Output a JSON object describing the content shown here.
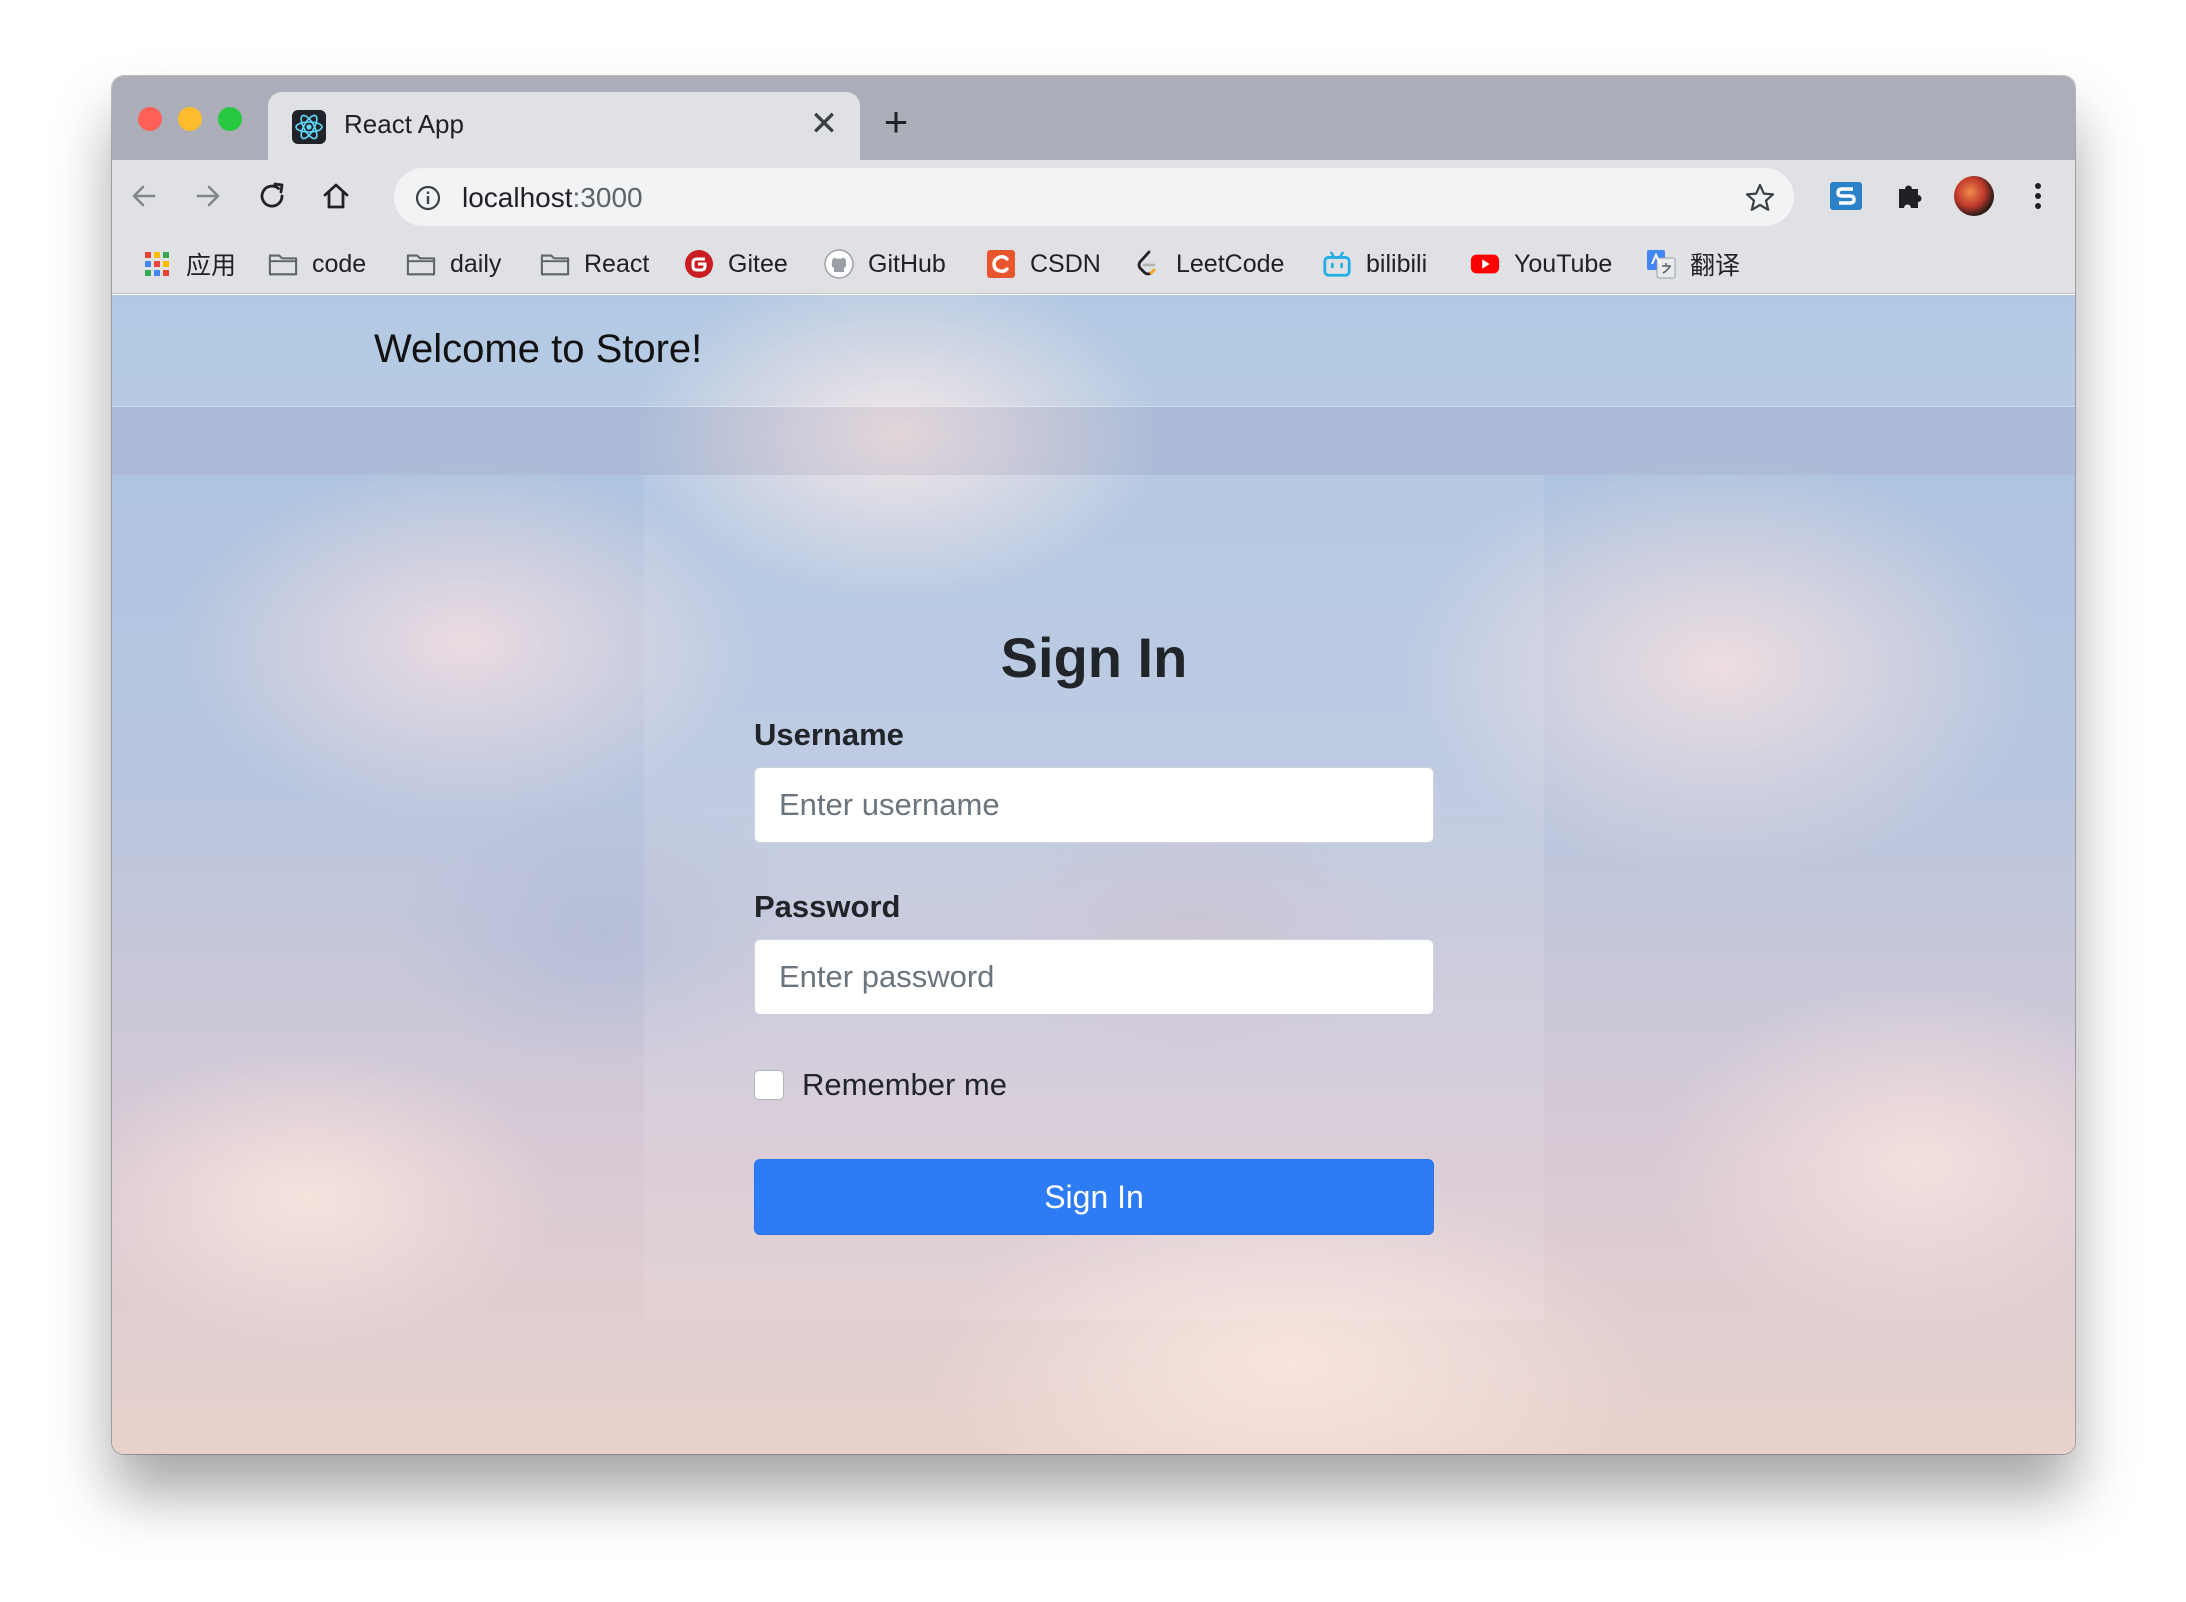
{
  "browser": {
    "tab": {
      "title": "React App",
      "close_symbol": "✕"
    },
    "new_tab_symbol": "+",
    "address_bar": {
      "host": "localhost",
      "port": ":3000"
    },
    "bookmarks": [
      {
        "label": "应用",
        "icon": "apps-grid-icon"
      },
      {
        "label": "code",
        "icon": "folder-icon"
      },
      {
        "label": "daily",
        "icon": "folder-icon"
      },
      {
        "label": "React",
        "icon": "folder-icon"
      },
      {
        "label": "Gitee",
        "icon": "gitee-icon"
      },
      {
        "label": "GitHub",
        "icon": "github-icon"
      },
      {
        "label": "CSDN",
        "icon": "csdn-icon"
      },
      {
        "label": "LeetCode",
        "icon": "leetcode-icon"
      },
      {
        "label": "bilibili",
        "icon": "bilibili-icon"
      },
      {
        "label": "YouTube",
        "icon": "youtube-icon"
      },
      {
        "label": "翻译",
        "icon": "google-translate-icon"
      }
    ]
  },
  "page": {
    "brand": "Welcome to Store!",
    "signin": {
      "title": "Sign In",
      "username_label": "Username",
      "username_placeholder": "Enter username",
      "password_label": "Password",
      "password_placeholder": "Enter password",
      "remember_label": "Remember me",
      "submit_label": "Sign In"
    }
  },
  "colors": {
    "primary_button": "#2d7cf6",
    "tab_strip": "#abaeb8",
    "toolbar": "#dfe1e5"
  }
}
